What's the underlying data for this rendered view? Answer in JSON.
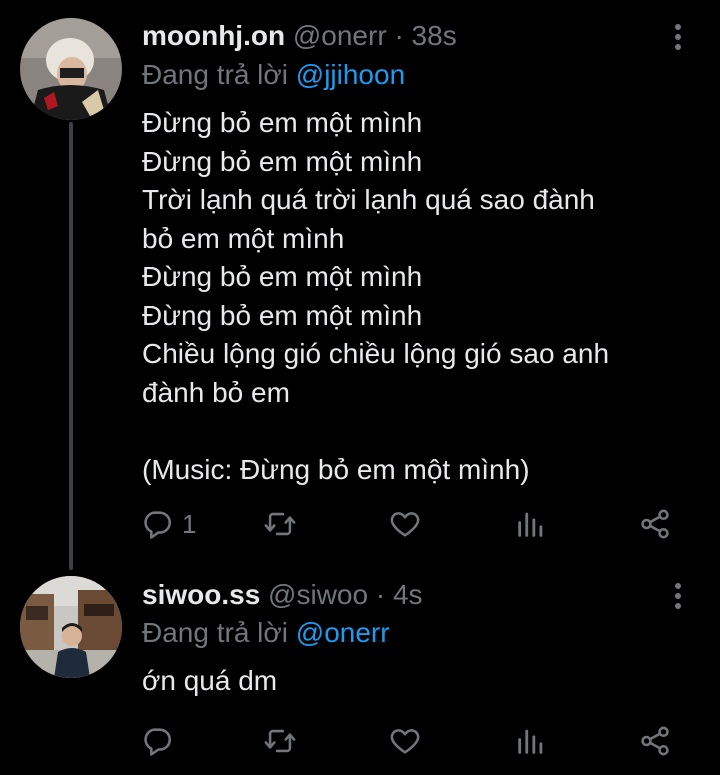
{
  "tweets": [
    {
      "display_name": "moonhj.on",
      "handle": "@onerr",
      "separator": "·",
      "time": "38s",
      "reply_prefix": "Đang trả lời",
      "reply_to": "@jjihoon",
      "lines": [
        "Đừng bỏ em một mình",
        "Đừng bỏ em một mình",
        "Trời lạnh quá trời lạnh quá sao đành",
        "bỏ em một mình",
        "Đừng bỏ em một mình",
        "Đừng bỏ em một mình",
        "Chiều lộng gió chiều lộng gió sao anh",
        "đành bỏ em",
        "",
        "(Music: Đừng bỏ em một mình)"
      ],
      "reply_count": "1",
      "avatar_icon": "profile-photo"
    },
    {
      "display_name": "siwoo.ss",
      "handle": "@siwoo",
      "separator": "·",
      "time": "4s",
      "reply_prefix": "Đang trả lời",
      "reply_to": "@onerr",
      "lines": [
        "ớn quá dm"
      ],
      "reply_count": "",
      "avatar_icon": "profile-photo"
    }
  ],
  "icons": {
    "more": "more-vertical-icon",
    "reply": "reply-icon",
    "retweet": "retweet-icon",
    "like": "heart-icon",
    "stats": "analytics-icon",
    "share": "share-icon"
  },
  "colors": {
    "background": "#000000",
    "text": "#e7e9ea",
    "muted": "#71767b",
    "link": "#1d9bf0",
    "thread_line": "#3e4144"
  }
}
